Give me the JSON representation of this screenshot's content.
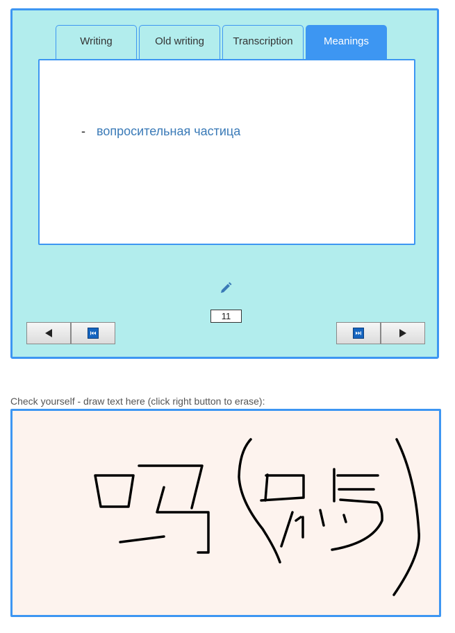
{
  "tabs": [
    {
      "label": "Writing",
      "active": false
    },
    {
      "label": "Old writing",
      "active": false
    },
    {
      "label": "Transcription",
      "active": false
    },
    {
      "label": "Meanings",
      "active": true
    }
  ],
  "meaning": {
    "bullet": "-",
    "text": "вопросительная частица"
  },
  "counter": "11",
  "icons": {
    "edit": "pencil-icon",
    "prev": "triangle-left-icon",
    "first": "skip-to-start-icon",
    "last": "skip-to-end-icon",
    "next": "triangle-right-icon"
  },
  "colors": {
    "card_bg": "#b2eded",
    "accent": "#3d96f2",
    "meaning_text": "#3a7ab7",
    "draw_bg": "#fdf3ee"
  },
  "draw": {
    "caption": "Check yourself - draw text here (click right button to erase):"
  }
}
